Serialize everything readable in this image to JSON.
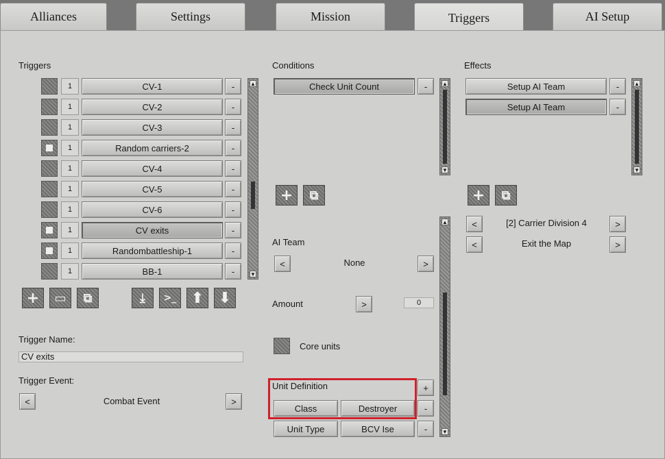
{
  "tabs": [
    {
      "label": "Alliances"
    },
    {
      "label": "Settings"
    },
    {
      "label": "Mission"
    },
    {
      "label": "Triggers"
    },
    {
      "label": "AI Setup"
    }
  ],
  "triggers": {
    "title": "Triggers",
    "rows": [
      {
        "priority": "1",
        "name": "CV-1",
        "remove": "-"
      },
      {
        "priority": "1",
        "name": "CV-2",
        "remove": "-"
      },
      {
        "priority": "1",
        "name": "CV-3",
        "remove": "-"
      },
      {
        "priority": "1",
        "name": "Random carriers-2",
        "remove": "-"
      },
      {
        "priority": "1",
        "name": "CV-4",
        "remove": "-"
      },
      {
        "priority": "1",
        "name": "CV-5",
        "remove": "-"
      },
      {
        "priority": "1",
        "name": "CV-6",
        "remove": "-"
      },
      {
        "priority": "1",
        "name": "CV exits",
        "remove": "-"
      },
      {
        "priority": "1",
        "name": "Randombattleship-1",
        "remove": "-"
      },
      {
        "priority": "1",
        "name": "BB-1",
        "remove": "-"
      }
    ],
    "name_label": "Trigger Name:",
    "name_value": "CV exits",
    "event_label": "Trigger Event:",
    "event_value": "Combat Event",
    "prev": "<",
    "next": ">"
  },
  "conditions": {
    "title": "Conditions",
    "items": [
      {
        "label": "Check Unit Count",
        "remove": "-"
      }
    ],
    "ai_team_label": "AI Team",
    "ai_team_value": "None",
    "prev": "<",
    "next": ">",
    "amount_label": "Amount",
    "amount_btn": ">",
    "amount_value": "0",
    "core_units_label": "Core units",
    "unit_def_label": "Unit Definition",
    "add": "+",
    "def_rows": [
      {
        "key": "Class",
        "value": "Destroyer",
        "remove": "-"
      },
      {
        "key": "Unit Type",
        "value": "BCV Ise",
        "remove": "-"
      }
    ]
  },
  "effects": {
    "title": "Effects",
    "items": [
      {
        "label": "Setup AI Team",
        "remove": "-"
      },
      {
        "label": "Setup AI Team",
        "remove": "-"
      }
    ],
    "param1": "[2] Carrier Division 4",
    "param2": "Exit the Map",
    "prev": "<",
    "next": ">"
  },
  "icons": {
    "add": "+",
    "copy": "⧉",
    "folder": "▭",
    "import": "⤓",
    "console": ">_",
    "up": "⬆",
    "down": "⬇"
  }
}
